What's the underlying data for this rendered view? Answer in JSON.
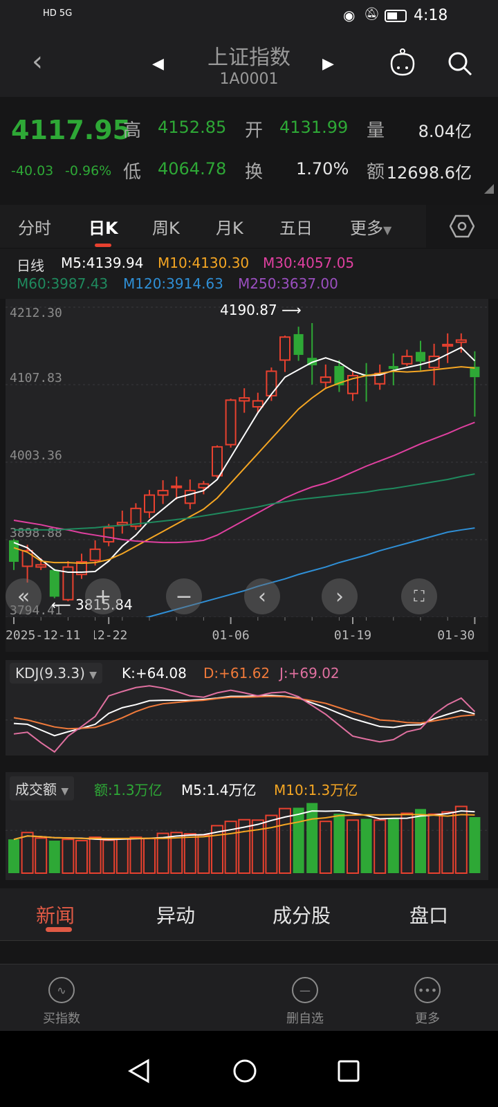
{
  "status_bar": {
    "left": "HD 5G",
    "time": "4:18"
  },
  "header": {
    "title": "上证指数",
    "code": "1A0001"
  },
  "quote": {
    "price": "4117.95",
    "change": "-40.03",
    "change_pct": "-0.96%",
    "high_label": "高",
    "high": "4152.85",
    "open_label": "开",
    "open": "4131.99",
    "volume_label": "量",
    "volume": "8.04亿",
    "low_label": "低",
    "low": "4064.78",
    "turnover_label": "换",
    "turnover": "1.70%",
    "amount_label": "额",
    "amount": "12698.6亿"
  },
  "tabs": [
    {
      "label": "分时"
    },
    {
      "label": "日K",
      "active": true
    },
    {
      "label": "周K"
    },
    {
      "label": "月K"
    },
    {
      "label": "五日"
    },
    {
      "label": "更多"
    }
  ],
  "ma_legend": {
    "period": "日线",
    "m5": "M5:4139.94",
    "m10": "M10:4130.30",
    "m30": "M30:4057.05",
    "m60": "M60:3987.43",
    "m120": "M120:3914.63",
    "m250": "M250:3637.00"
  },
  "colors": {
    "up": "#e8412f",
    "down": "#2ea836",
    "m5": "#ffffff",
    "m10": "#f5a623",
    "m30": "#e040a0",
    "m60": "#1f8a5e",
    "m120": "#2f8fd6",
    "m250": "#9b4fc0",
    "k": "#ffffff",
    "d": "#f07a3a",
    "j": "#e070a0"
  },
  "chart_data": [
    {
      "type": "candlestick",
      "y_ticks": [
        "4212.30",
        "4107.83",
        "4003.36",
        "3898.88",
        "3794.41"
      ],
      "ylim": [
        3794.41,
        4212.3
      ],
      "x_ticks": [
        {
          "index": 0,
          "label": "2025-12-11"
        },
        {
          "index": 7,
          "label": "12-22"
        },
        {
          "index": 16,
          "label": "01-06"
        },
        {
          "index": 25,
          "label": "01-19"
        },
        {
          "index": 34,
          "label": "01-30"
        }
      ],
      "annotations": {
        "max": "4190.87",
        "min": "3815.84"
      },
      "ohlc": [
        [
          3898,
          3900,
          3858,
          3869
        ],
        [
          3863,
          3892,
          3841,
          3884
        ],
        [
          3862,
          3874,
          3858,
          3865
        ],
        [
          3858,
          3860,
          3820,
          3822
        ],
        [
          3818,
          3870,
          3815.84,
          3862
        ],
        [
          3852,
          3880,
          3846,
          3869
        ],
        [
          3871,
          3898,
          3864,
          3886
        ],
        [
          3896,
          3920,
          3890,
          3915
        ],
        [
          3919,
          3938,
          3907,
          3922
        ],
        [
          3917,
          3948,
          3912,
          3941
        ],
        [
          3936,
          3966,
          3928,
          3959
        ],
        [
          3959,
          3979,
          3947,
          3965
        ],
        [
          3970,
          3984,
          3953,
          3971
        ],
        [
          3948,
          3980,
          3940,
          3965
        ],
        [
          3969,
          3978,
          3960,
          3974
        ],
        [
          3985,
          4026,
          3982,
          4024
        ],
        [
          4027,
          4089,
          4023,
          4087
        ],
        [
          4086,
          4103,
          4070,
          4090
        ],
        [
          4078,
          4097,
          4070,
          4086
        ],
        [
          4093,
          4131,
          4086,
          4126
        ],
        [
          4141,
          4174,
          4125,
          4172
        ],
        [
          4176,
          4186,
          4140,
          4148
        ],
        [
          4144,
          4190.87,
          4108,
          4134
        ],
        [
          4111,
          4135,
          4102,
          4118
        ],
        [
          4133,
          4141,
          4098,
          4107
        ],
        [
          4096,
          4125,
          4086,
          4120
        ],
        [
          4122,
          4137,
          4085,
          4120
        ],
        [
          4109,
          4135,
          4101,
          4123
        ],
        [
          4133,
          4150,
          4107,
          4129
        ],
        [
          4136,
          4155,
          4133,
          4146
        ],
        [
          4152,
          4167,
          4127,
          4139
        ],
        [
          4131,
          4163,
          4107,
          4146
        ],
        [
          4160,
          4177,
          4137,
          4162
        ],
        [
          4165,
          4177,
          4151,
          4168
        ],
        [
          4131.99,
          4152.85,
          4064.78,
          4117.95
        ]
      ],
      "series": [
        {
          "name": "M5",
          "values": [
            3895,
            3888,
            3872,
            3858,
            3855,
            3855,
            3856,
            3870,
            3890,
            3905,
            3925,
            3940,
            3955,
            3960,
            3965,
            3980,
            4010,
            4040,
            4070,
            4095,
            4118,
            4128,
            4138,
            4144,
            4138,
            4126,
            4120,
            4121,
            4127,
            4131,
            4135,
            4140,
            4149,
            4158,
            4139.94
          ]
        },
        {
          "name": "M10",
          "values": [
            3888,
            3882,
            3870,
            3868,
            3868,
            3867,
            3868,
            3872,
            3880,
            3890,
            3900,
            3910,
            3920,
            3930,
            3940,
            3955,
            3975,
            3995,
            4015,
            4035,
            4055,
            4075,
            4090,
            4103,
            4110,
            4116,
            4120,
            4123,
            4126,
            4125,
            4126,
            4128,
            4130,
            4132,
            4130.3
          ]
        },
        {
          "name": "M30",
          "values": [
            3925,
            3922,
            3919,
            3915,
            3912,
            3908,
            3905,
            3902,
            3899,
            3897,
            3896,
            3895,
            3895,
            3896,
            3898,
            3905,
            3915,
            3925,
            3935,
            3945,
            3955,
            3963,
            3970,
            3975,
            3982,
            3990,
            3998,
            4005,
            4012,
            4020,
            4028,
            4035,
            4042,
            4050,
            4057.05
          ]
        },
        {
          "name": "M60",
          "values": [
            3912,
            3912,
            3912,
            3912,
            3913,
            3914,
            3915,
            3917,
            3918,
            3920,
            3922,
            3924,
            3926,
            3928,
            3931,
            3934,
            3937,
            3940,
            3943,
            3947,
            3950,
            3953,
            3955,
            3957,
            3959,
            3961,
            3963,
            3966,
            3968,
            3971,
            3974,
            3977,
            3980,
            3984,
            3987.43
          ]
        },
        {
          "name": "M120",
          "values": [
            3745,
            3750,
            3755,
            3760,
            3765,
            3770,
            3775,
            3780,
            3785,
            3790,
            3795,
            3800,
            3805,
            3810,
            3815,
            3820,
            3825,
            3830,
            3836,
            3841,
            3846,
            3852,
            3857,
            3862,
            3868,
            3873,
            3878,
            3884,
            3889,
            3894,
            3899,
            3904,
            3909,
            3912,
            3914.63
          ]
        }
      ]
    },
    {
      "type": "line",
      "title": "KDJ(9.3.3)",
      "ylim": [
        -25,
        130
      ],
      "series": [
        {
          "name": "K",
          "label": "K:+64.08",
          "values": [
            42,
            40,
            27,
            14,
            23,
            31,
            40,
            65,
            78,
            85,
            94,
            95,
            95,
            95,
            97,
            100,
            104,
            104,
            105,
            106,
            104,
            100,
            89,
            78,
            65,
            53,
            44,
            35,
            33,
            38,
            39,
            53,
            63,
            72,
            64.08
          ]
        },
        {
          "name": "D",
          "label": "D:+61.62",
          "values": [
            55,
            50,
            42,
            34,
            30,
            31,
            33,
            43,
            55,
            69,
            80,
            87,
            90,
            93,
            95,
            99,
            102,
            102,
            103,
            104,
            103,
            99,
            94,
            88,
            78,
            68,
            59,
            50,
            48,
            44,
            43,
            48,
            53,
            59,
            61.62
          ]
        },
        {
          "name": "J",
          "label": "J:+69.02",
          "values": [
            18,
            22,
            -2,
            -23,
            13,
            35,
            58,
            105,
            115,
            124,
            128,
            123,
            115,
            105,
            102,
            112,
            118,
            112,
            105,
            112,
            114,
            103,
            83,
            63,
            38,
            13,
            6,
            0,
            5,
            23,
            30,
            63,
            85,
            100,
            69.02
          ]
        }
      ]
    },
    {
      "type": "bar",
      "title": "成交额",
      "unit": "万亿",
      "ylim": [
        0,
        1.65
      ],
      "labels": {
        "amount": "额:1.3万亿",
        "m5": "M5:1.4万亿",
        "m10": "M10:1.3万亿"
      },
      "values": [
        0.79,
        0.95,
        0.82,
        0.76,
        0.79,
        0.76,
        0.84,
        0.77,
        0.81,
        0.84,
        0.81,
        0.93,
        0.95,
        0.92,
        0.89,
        1.11,
        1.21,
        1.25,
        1.24,
        1.35,
        1.51,
        1.53,
        1.64,
        1.21,
        1.39,
        1.24,
        1.27,
        1.24,
        1.27,
        1.4,
        1.5,
        1.38,
        1.43,
        1.56,
        1.31
      ]
    }
  ],
  "bottom_tabs": [
    {
      "label": "新闻",
      "active": true
    },
    {
      "label": "异动"
    },
    {
      "label": "成分股"
    },
    {
      "label": "盘口"
    }
  ],
  "bottom_bar": [
    {
      "label": "买指数",
      "icon": "wave-chart-icon"
    },
    {
      "label": "删自选",
      "icon": "minus-circle-icon"
    },
    {
      "label": "更多",
      "icon": "more-dots-icon"
    }
  ]
}
